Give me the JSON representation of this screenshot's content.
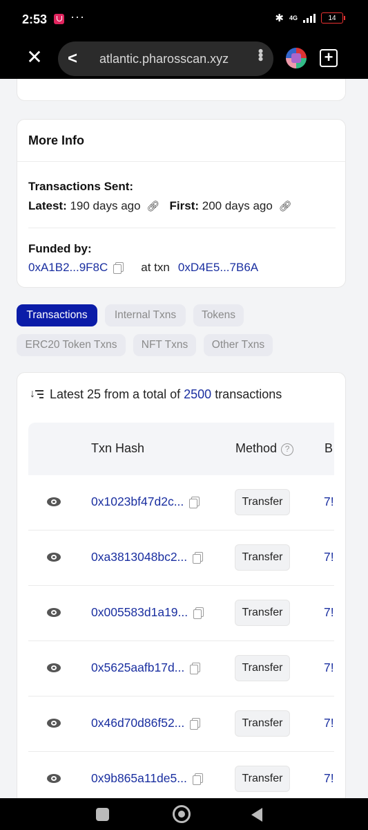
{
  "status_bar": {
    "time": "2:53",
    "dots": "···",
    "bluetooth_glyph": "✱",
    "network": "4G",
    "battery": "14"
  },
  "browser": {
    "close_glyph": "✕",
    "back_glyph": "<",
    "url": "atlantic.pharosscan.xyz",
    "menu_glyph": "•••",
    "new_tab_glyph": "+"
  },
  "more_info": {
    "title": "More Info",
    "transactions_sent_label": "Transactions Sent:",
    "latest_label": "Latest:",
    "latest_value": "190 days ago",
    "first_label": "First:",
    "first_value": "200 days ago",
    "funded_by_label": "Funded by:",
    "funded_by_address": "0xA1B2...9F8C",
    "at_txn_label": "at txn",
    "funded_txn": "0xD4E5...7B6A"
  },
  "tabs": [
    {
      "label": "Transactions",
      "active": true
    },
    {
      "label": "Internal Txns",
      "active": false
    },
    {
      "label": "Tokens",
      "active": false
    },
    {
      "label": "ERC20 Token Txns",
      "active": false
    },
    {
      "label": "NFT Txns",
      "active": false
    },
    {
      "label": "Other Txns",
      "active": false
    }
  ],
  "transactions": {
    "summary_prefix": "Latest 25 from a total of",
    "total": "2500",
    "summary_suffix": "transactions",
    "columns": {
      "txn_hash": "Txn Hash",
      "method": "Method",
      "method_help": "?",
      "block_cut": "B"
    },
    "rows": [
      {
        "hash": "0x1023bf47d2c...",
        "method": "Transfer",
        "block_cut": "7!"
      },
      {
        "hash": "0xa3813048bc2...",
        "method": "Transfer",
        "block_cut": "7!"
      },
      {
        "hash": "0x005583d1a19...",
        "method": "Transfer",
        "block_cut": "7!"
      },
      {
        "hash": "0x5625aafb17d...",
        "method": "Transfer",
        "block_cut": "7!"
      },
      {
        "hash": "0x46d70d86f52...",
        "method": "Transfer",
        "block_cut": "7!"
      },
      {
        "hash": "0x9b865a11de5...",
        "method": "Transfer",
        "block_cut": "7!"
      }
    ]
  },
  "colors": {
    "accent": "#0b1ca8",
    "link": "#1a2fa0",
    "tab_inactive_bg": "#e9eaf0"
  }
}
